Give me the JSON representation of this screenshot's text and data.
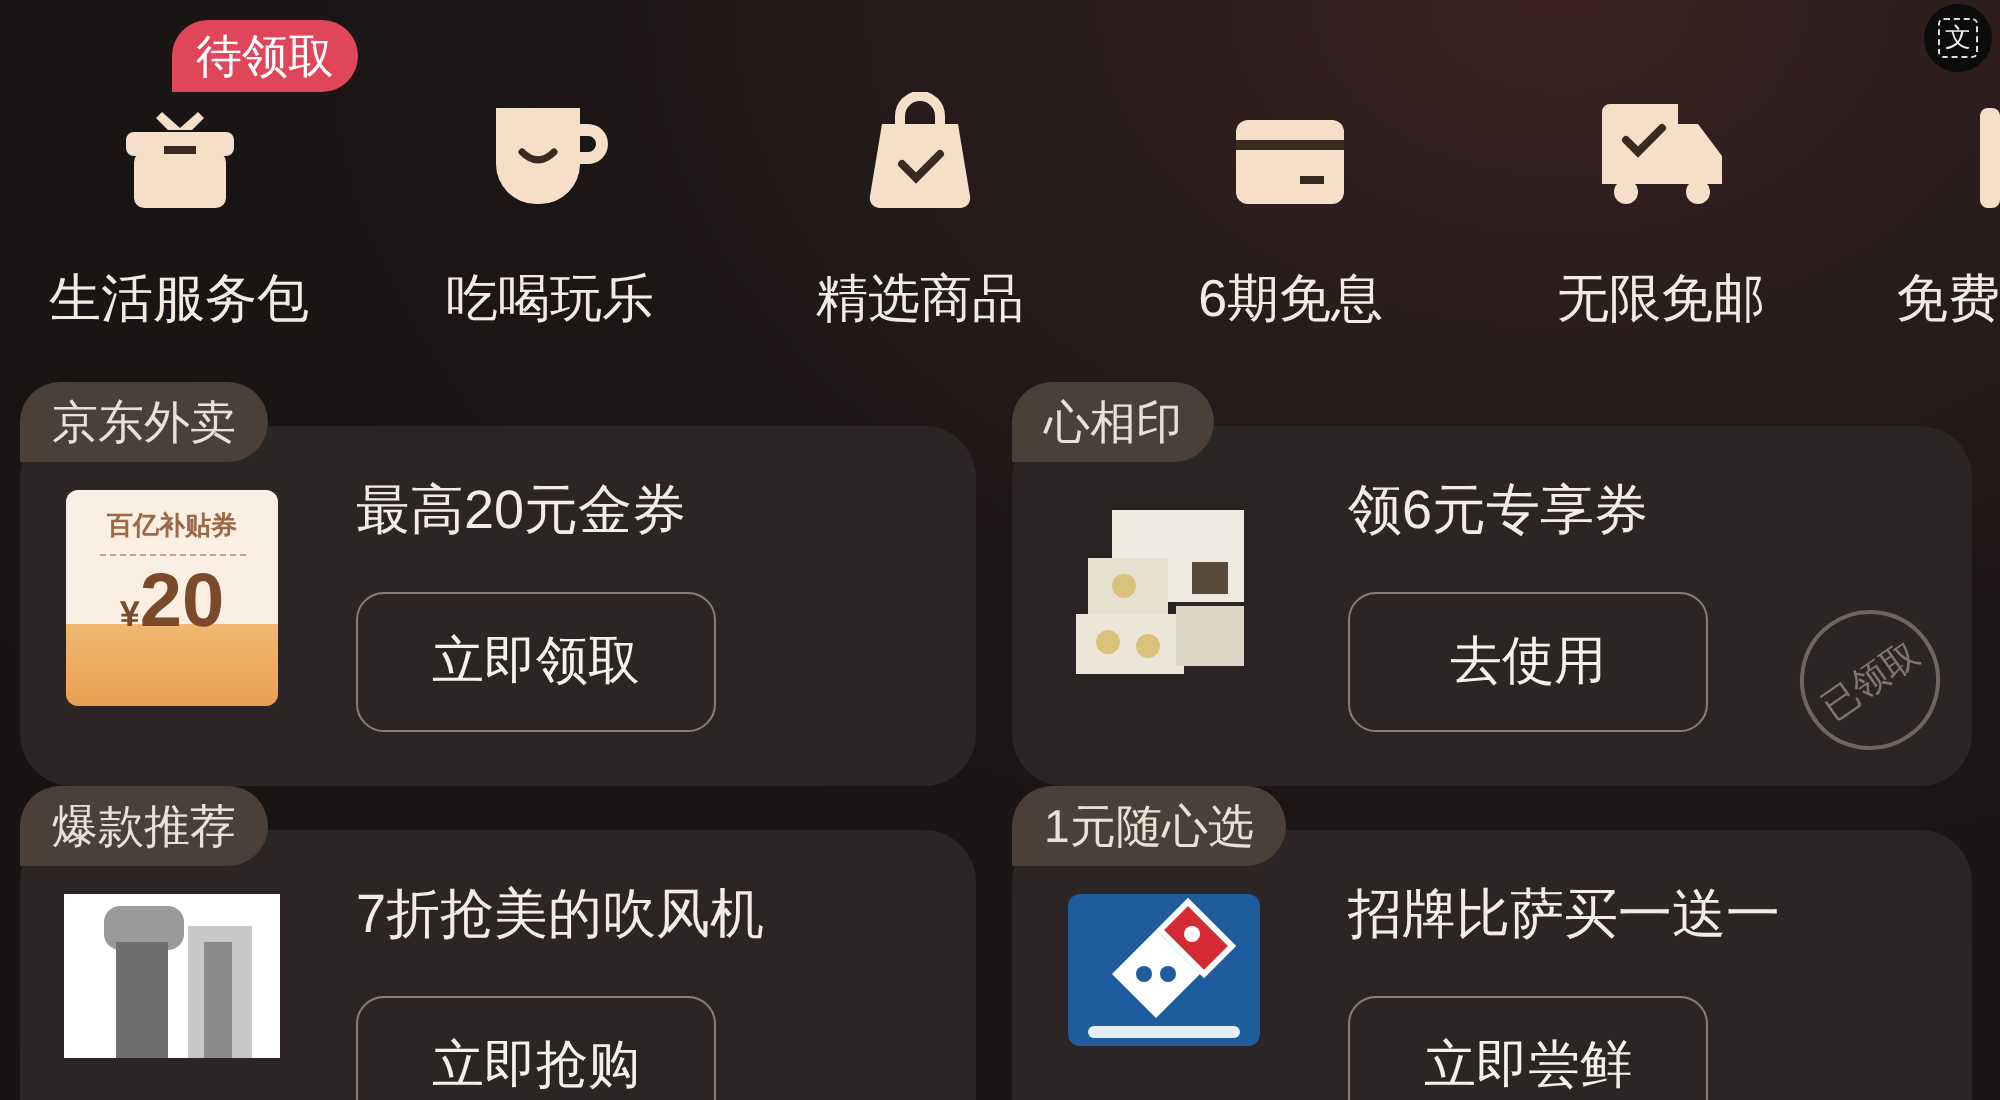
{
  "translate_button": {
    "label": "文"
  },
  "services": [
    {
      "label": "生活服务包",
      "badge": "待领取"
    },
    {
      "label": "吃喝玩乐"
    },
    {
      "label": "精选商品"
    },
    {
      "label": "6期免息"
    },
    {
      "label": "无限免邮"
    },
    {
      "label": "免费"
    }
  ],
  "offers": [
    {
      "tag": "京东外卖",
      "title": "最高20元金券",
      "button": "立即领取",
      "image": {
        "kind": "coupon",
        "caption": "百亿补贴券",
        "currency": "¥",
        "amount": "20"
      }
    },
    {
      "tag": "心相印",
      "title": "领6元专享券",
      "button": "去使用",
      "stamp": "已领取"
    },
    {
      "tag": "爆款推荐",
      "title": "7折抢美的吹风机",
      "button": "立即抢购"
    },
    {
      "tag": "1元随心选",
      "title": "招牌比萨买一送一",
      "button": "立即尝鲜"
    }
  ]
}
